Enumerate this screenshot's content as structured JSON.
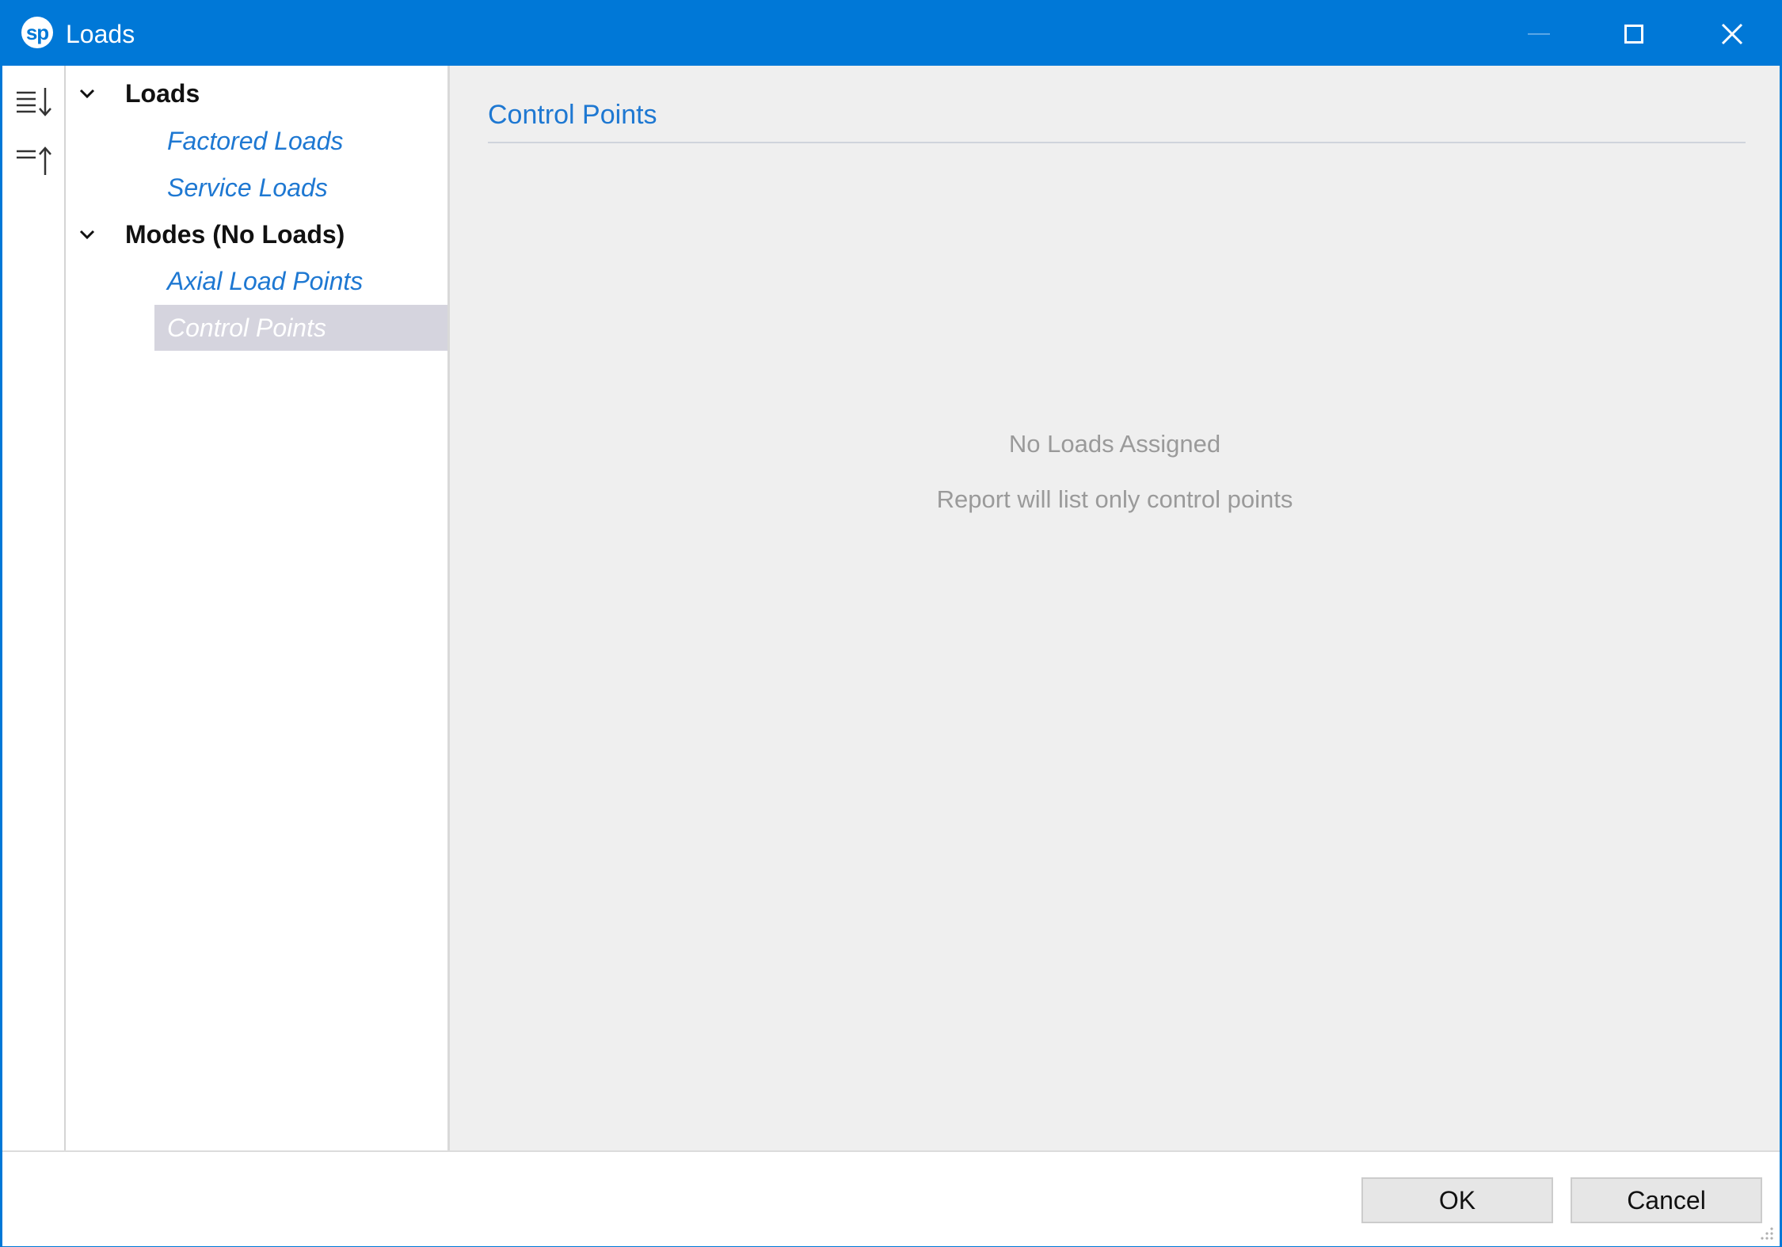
{
  "window": {
    "logo_text": "sp",
    "title": "Loads",
    "accent_color": "#0078d7"
  },
  "toolstrip": {
    "tools": [
      {
        "icon": "expand-all-icon"
      },
      {
        "icon": "collapse-all-icon"
      }
    ]
  },
  "tree": {
    "groups": [
      {
        "label": "Loads",
        "expanded": true,
        "items": [
          {
            "label": "Factored Loads"
          },
          {
            "label": "Service Loads"
          }
        ]
      },
      {
        "label": "Modes (No Loads)",
        "expanded": true,
        "items": [
          {
            "label": "Axial Load Points"
          },
          {
            "label": "Control Points",
            "selected": true
          }
        ]
      }
    ]
  },
  "content": {
    "title": "Control Points",
    "empty_title": "No Loads Assigned",
    "empty_subtitle": "Report will list only control points"
  },
  "footer": {
    "ok_label": "OK",
    "cancel_label": "Cancel"
  }
}
